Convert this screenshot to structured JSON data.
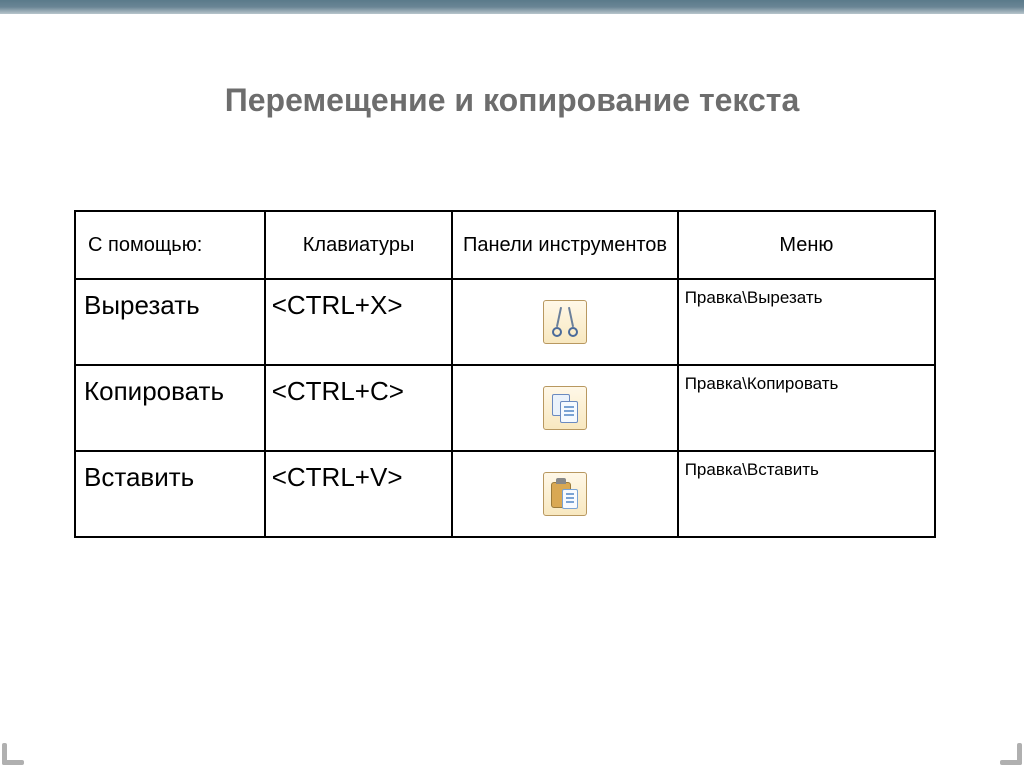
{
  "title": "Перемещение и копирование текста",
  "headers": {
    "col1": "С помощью:",
    "col2": "Клавиатуры",
    "col3": "Панели инструментов",
    "col4": "Меню"
  },
  "rows": [
    {
      "action": "Вырезать",
      "shortcut": "<CTRL+X>",
      "icon": "scissors-icon",
      "menu": "Правка\\Вырезать"
    },
    {
      "action": "Копировать",
      "shortcut": "<CTRL+C>",
      "icon": "copy-icon",
      "menu": "Правка\\Копировать"
    },
    {
      "action": "Вставить",
      "shortcut": "<CTRL+V>",
      "icon": "paste-icon",
      "menu": "Правка\\Вставить"
    }
  ]
}
